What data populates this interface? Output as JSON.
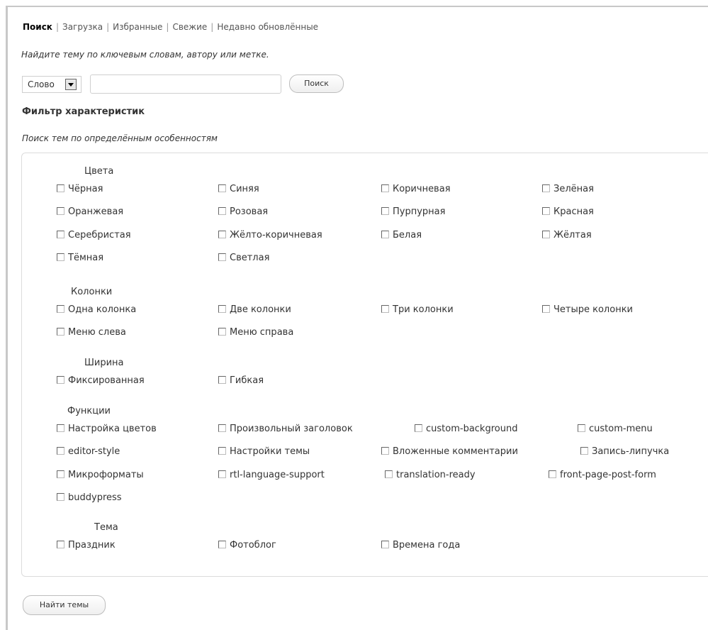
{
  "tabs": [
    {
      "label": "Поиск",
      "active": true
    },
    {
      "label": "Загрузка",
      "active": false
    },
    {
      "label": "Избранные",
      "active": false
    },
    {
      "label": "Свежие",
      "active": false
    },
    {
      "label": "Недавно обновлённые",
      "active": false
    }
  ],
  "search": {
    "intro": "Найдите тему по ключевым словам, автору или метке.",
    "type_value": "Слово",
    "input_value": "",
    "button_label": "Поиск"
  },
  "filter": {
    "title": "Фильтр характеристик",
    "subtitle": "Поиск тем по определённым особенностям",
    "groups": [
      {
        "title": "Цвета",
        "items": [
          "Чёрная",
          "Синяя",
          "Коричневая",
          "Зелёная",
          "Оранжевая",
          "Розовая",
          "Пурпурная",
          "Красная",
          "Серебристая",
          "Жёлто-коричневая",
          "Белая",
          "Жёлтая",
          "Тёмная",
          "Светлая"
        ]
      },
      {
        "title": "Колонки",
        "items": [
          "Одна колонка",
          "Две колонки",
          "Три колонки",
          "Четыре колонки",
          "Меню слева",
          "Меню справа"
        ]
      },
      {
        "title": "Ширина",
        "items": [
          "Фиксированная",
          "Гибкая"
        ]
      },
      {
        "title": "Функции",
        "items": [
          "Настройка цветов",
          "Произвольный заголовок",
          "custom-background",
          "custom-menu",
          "editor-style",
          "Настройки темы",
          "Вложенные комментарии",
          "Запись-липучка",
          "Микроформаты",
          "rtl-language-support",
          "translation-ready",
          "front-page-post-form",
          "buddypress"
        ]
      },
      {
        "title": "Тема",
        "items": [
          "Праздник",
          "Фотоблог",
          "Времена года"
        ]
      }
    ]
  },
  "find_button": "Найти темы"
}
